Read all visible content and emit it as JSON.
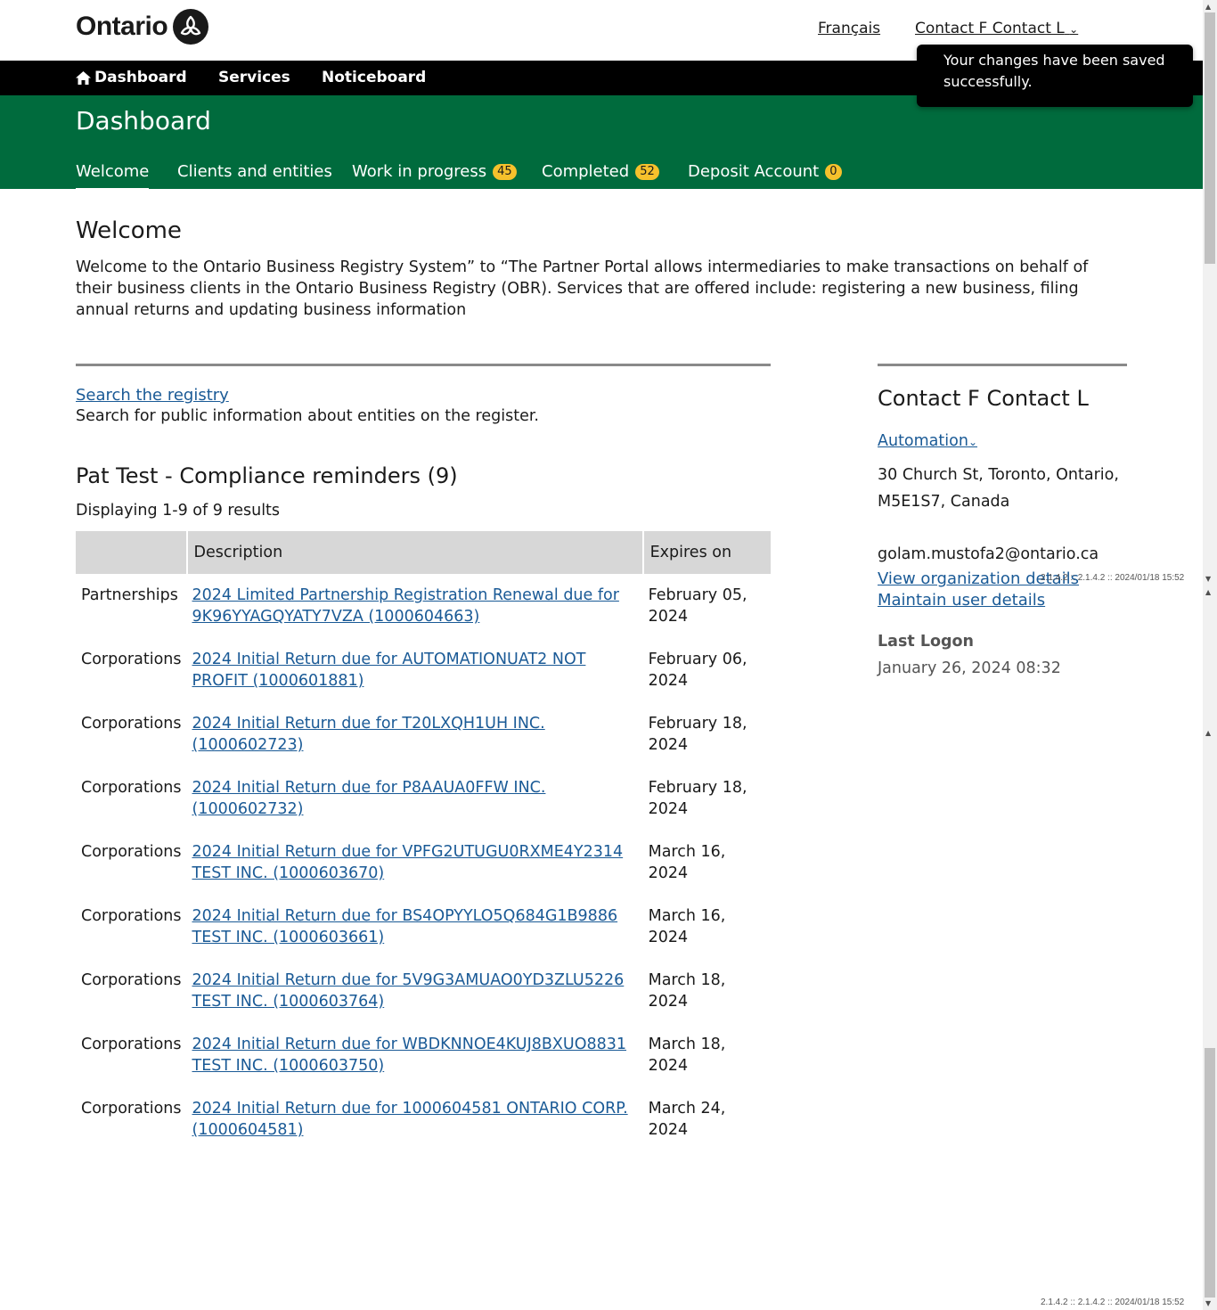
{
  "header": {
    "logo_text": "Ontario",
    "language_link": "Français",
    "user_menu": "Contact F Contact L"
  },
  "nav": {
    "dashboard": "Dashboard",
    "services": "Services",
    "noticeboard": "Noticeboard"
  },
  "toast": {
    "message": "Your changes have been saved successfully."
  },
  "page": {
    "title": "Dashboard",
    "tabs": [
      {
        "label": "Welcome",
        "badge": null
      },
      {
        "label": "Clients and entities",
        "badge": null
      },
      {
        "label": "Work in progress",
        "badge": "45"
      },
      {
        "label": "Completed",
        "badge": "52"
      },
      {
        "label": "Deposit Account",
        "badge": "0"
      }
    ]
  },
  "welcome": {
    "heading": "Welcome",
    "text": "Welcome to the Ontario Business Registry System” to “The Partner Portal allows intermediaries to make transactions on behalf of their business clients in the Ontario Business Registry (OBR). Services that are offered include: registering a new business, filing annual returns and updating business information"
  },
  "search": {
    "link": "Search the registry",
    "description": "Search for public information about entities on the register."
  },
  "reminders": {
    "heading": "Pat Test - Compliance reminders (9)",
    "results_text": "Displaying 1-9 of 9 results",
    "columns": [
      "",
      "Description",
      "Expires on"
    ],
    "rows": [
      {
        "category": "Partnerships",
        "description": "2024 Limited Partnership Registration Renewal due for 9K96YYAGQYATY7VZA (1000604663)",
        "expires": "February 05, 2024"
      },
      {
        "category": "Corporations",
        "description": "2024 Initial Return due for AUTOMATIONUAT2 NOT PROFIT (1000601881)",
        "expires": "February 06, 2024"
      },
      {
        "category": "Corporations",
        "description": "2024 Initial Return due for T20LXQH1UH INC. (1000602723)",
        "expires": "February 18, 2024"
      },
      {
        "category": "Corporations",
        "description": "2024 Initial Return due for P8AAUA0FFW INC. (1000602732)",
        "expires": "February 18, 2024"
      },
      {
        "category": "Corporations",
        "description": "2024 Initial Return due for VPFG2UTUGU0RXME4Y2314 TEST INC. (1000603670)",
        "expires": "March 16, 2024"
      },
      {
        "category": "Corporations",
        "description": "2024 Initial Return due for BS4OPYYLO5Q684G1B9886 TEST INC. (1000603661)",
        "expires": "March 16, 2024"
      },
      {
        "category": "Corporations",
        "description": "2024 Initial Return due for 5V9G3AMUAO0YD3ZLU5226 TEST INC. (1000603764)",
        "expires": "March 18, 2024"
      },
      {
        "category": "Corporations",
        "description": "2024 Initial Return due for WBDKNNOE4KUJ8BXUO8831 TEST INC. (1000603750)",
        "expires": "March 18, 2024"
      },
      {
        "category": "Corporations",
        "description": "2024 Initial Return due for 1000604581 ONTARIO CORP. (1000604581)",
        "expires": "March 24, 2024"
      }
    ]
  },
  "contact": {
    "name": "Contact F Contact L",
    "organization": "Automation",
    "address": "30 Church St, Toronto, Ontario, M5E1S7, Canada",
    "email": "golam.mustofa2@ontario.ca",
    "view_org_link": "View organization details",
    "maintain_user_link": "Maintain user details",
    "last_logon_label": "Last Logon",
    "last_logon_value": "January 26, 2024 08:32"
  },
  "version": "2.1.4.2 :: 2.1.4.2 :: 2024/01/18 15:52",
  "colors": {
    "green": "#006b3d",
    "nav_black": "#000000",
    "badge": "#f6c12c",
    "link": "#1a5a96"
  }
}
